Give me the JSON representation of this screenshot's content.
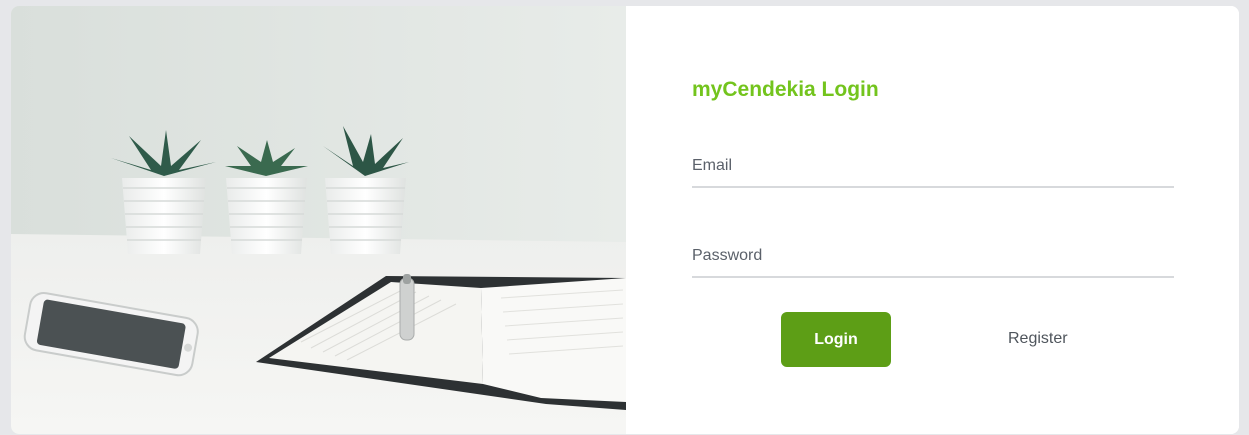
{
  "login": {
    "title": "myCendekia Login",
    "email_placeholder": "Email",
    "email_value": "",
    "password_placeholder": "Password",
    "password_value": "",
    "login_label": "Login",
    "register_label": "Register"
  },
  "colors": {
    "title_green": "#73c41d",
    "button_green": "#5d9e16",
    "page_bg": "#e6e7ea"
  },
  "photo": {
    "subject": "desk-scene-image"
  }
}
